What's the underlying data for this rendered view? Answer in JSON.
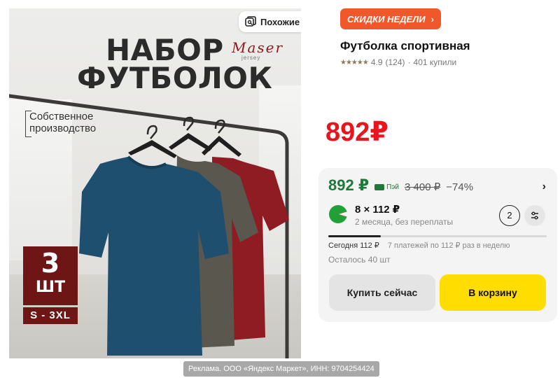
{
  "image": {
    "title_line1": "НАБОР",
    "title_line2": "ФУТБОЛОК",
    "brand_name": "Maser",
    "brand_sub": "jersey",
    "similar_button": "Похожие",
    "own_production_line1": "Собственное",
    "own_production_line2": "производство",
    "count_number": "3",
    "count_unit": "ШТ",
    "size_range": "S - 3XL",
    "shirt_colors": [
      "#1e4f6e",
      "#5a574f",
      "#8e1c22"
    ]
  },
  "sale_badge": {
    "label": "СКИДКИ НЕДЕЛИ",
    "chevron": "›",
    "color": "#f0582b"
  },
  "product": {
    "title": "Футболка спортивная",
    "stars": "★★★★★",
    "rating": "4.9",
    "reviews": "(124)",
    "separator": "·",
    "purchases": "401 купили",
    "price": "892₽"
  },
  "offer_card": {
    "price": "892 ₽",
    "pay_label": "Пэй",
    "old_price": "3 400 ₽",
    "discount": "−74%",
    "chevron": "›",
    "split_amount": "8 × 112 ₽",
    "split_terms": "2 месяца, без переплаты",
    "months": "2",
    "progress_fraction": 0.24,
    "today_payment": "Сегодня 112 ₽",
    "schedule": "7 платежей по 112 ₽ раз в неделю",
    "stock": "Осталось 40 шт",
    "buy_now": "Купить сейчас",
    "to_cart": "В корзину"
  },
  "footer": {
    "ad_text": "Реклама. ООО «Яндекс Маркет», ИНН: 9704254424"
  },
  "colors": {
    "price_red": "#e8141e",
    "pay_green": "#1d7a3a",
    "cart_yellow": "#ffdd00"
  }
}
